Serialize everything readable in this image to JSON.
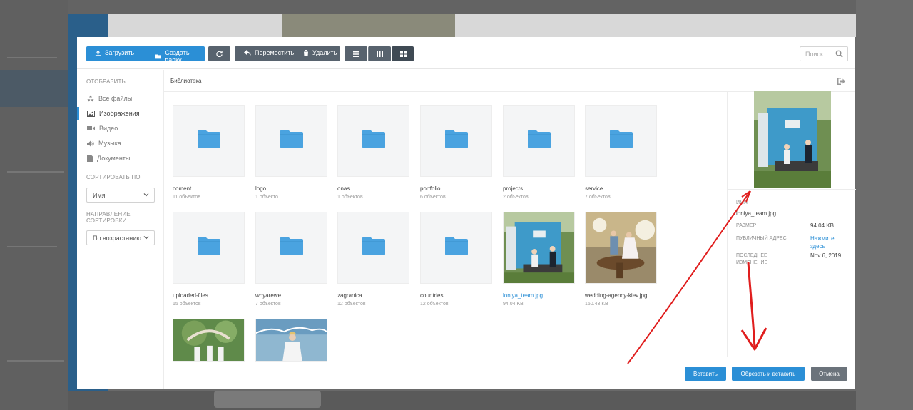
{
  "toolbar": {
    "upload_label": "Загрузить",
    "create_folder_label": "Создать папку",
    "move_label": "Переместить",
    "delete_label": "Удалить",
    "search_placeholder": "Поиск"
  },
  "sidebar": {
    "display_heading": "ОТОБРАЗИТЬ",
    "items": [
      {
        "label": "Все файлы",
        "icon": "recycle-icon"
      },
      {
        "label": "Изображения",
        "icon": "image-icon"
      },
      {
        "label": "Видео",
        "icon": "video-icon"
      },
      {
        "label": "Музыка",
        "icon": "music-icon"
      },
      {
        "label": "Документы",
        "icon": "document-icon"
      }
    ],
    "sort_heading": "СОРТИРОВАТЬ ПО",
    "sort_value": "Имя",
    "direction_heading_1": "НАПРАВЛЕНИЕ",
    "direction_heading_2": "СОРТИРОВКИ",
    "direction_value": "По возрастанию"
  },
  "breadcrumb": "Библиотека",
  "files": [
    {
      "name": "coment",
      "meta": "11 объектов",
      "type": "folder"
    },
    {
      "name": "logo",
      "meta": "1 объекто",
      "type": "folder"
    },
    {
      "name": "onas",
      "meta": "1 объектов",
      "type": "folder"
    },
    {
      "name": "portfolio",
      "meta": "6 объектов",
      "type": "folder"
    },
    {
      "name": "projects",
      "meta": "2 объектов",
      "type": "folder"
    },
    {
      "name": "service",
      "meta": "7 объектов",
      "type": "folder"
    },
    {
      "name": "uploaded-files",
      "meta": "15 объектов",
      "type": "folder"
    },
    {
      "name": "whyarewe",
      "meta": "7 объектов",
      "type": "folder"
    },
    {
      "name": "zagranica",
      "meta": "12 объектов",
      "type": "folder"
    },
    {
      "name": "countries",
      "meta": "12 объектов",
      "type": "folder"
    },
    {
      "name": "loniya_team.jpg",
      "meta": "94.04 KB",
      "type": "image"
    },
    {
      "name": "wedding-agency-kiev.jpg",
      "meta": "150.43 KB",
      "type": "image"
    }
  ],
  "info": {
    "name_label": "ИМЯ",
    "name_value": "loniya_team.jpg",
    "size_label": "РАЗМЕР",
    "size_value": "94.04 KB",
    "public_label_1": "ПУБЛИЧНЫЙ АДРЕС",
    "public_value_1": "Нажмите",
    "public_value_2": "здесь",
    "modified_label_1": "ПОСЛЕДНЕЕ",
    "modified_label_2": "ИЗМЕНЕНИЕ",
    "modified_value": "Nov 6, 2019"
  },
  "footer": {
    "insert_label": "Вставить",
    "crop_insert_label": "Обрезать и вставить",
    "cancel_label": "Отмена"
  },
  "colors": {
    "accent": "#2b8fd6",
    "toolbar_gray": "#58636e",
    "folder": "#4aa3e0",
    "annotation": "#e01e1e"
  }
}
